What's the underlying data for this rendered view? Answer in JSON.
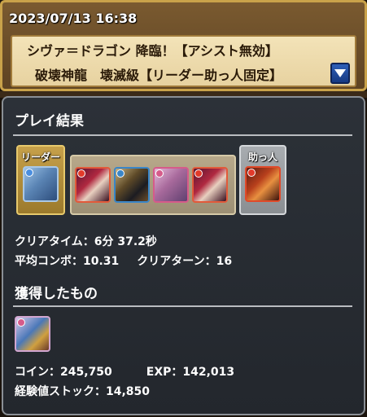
{
  "header": {
    "datetime": "2023/07/13 16:38",
    "line1": "シヴァ＝ドラゴン 降臨！【アシスト無効】",
    "line2": "破壊神龍　壊滅級【リーダー助っ人固定】"
  },
  "result": {
    "title": "プレイ結果",
    "leader_label": "リーダー",
    "helper_label": "助っ人",
    "clear_time_label": "クリアタイム：",
    "clear_time_value": "6分 37.2秒",
    "avg_combo_label": "平均コンボ：",
    "avg_combo_value": "10.31",
    "clear_turn_label": "クリアターン：",
    "clear_turn_value": "16"
  },
  "rewards": {
    "title": "獲得したもの",
    "coin_label": "コイン：",
    "coin_value": "245,750",
    "exp_label": "EXP：",
    "exp_value": "142,013",
    "stock_label": "経験値ストック：",
    "stock_value": "14,850"
  },
  "team": {
    "leader": {
      "icon": "shiva-dragon-monster-icon",
      "attribute_color": "#4a8ee0"
    },
    "members": [
      {
        "icon": "red-haired-monster-icon",
        "attribute_color": "#e23a2a"
      },
      {
        "icon": "hooded-monster-icon",
        "attribute_color": "#3a86c8"
      },
      {
        "icon": "pink-haired-monster-icon",
        "attribute_color": "#d65b8a"
      },
      {
        "icon": "red-haired-monster-icon",
        "attribute_color": "#e23a2a"
      }
    ],
    "helper": {
      "icon": "red-dragon-monster-icon",
      "attribute_color": "#e23a2a"
    }
  },
  "obtained_items": [
    {
      "icon": "dragon-knight-monster-icon"
    }
  ]
}
